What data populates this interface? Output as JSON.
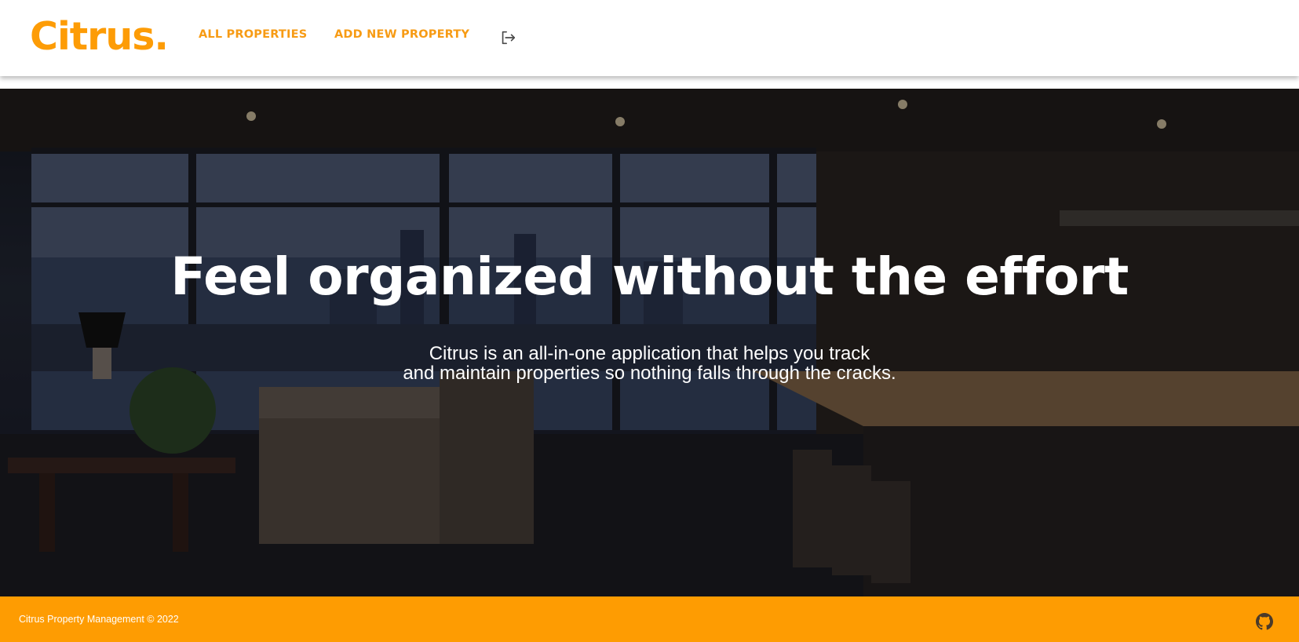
{
  "header": {
    "logo": "Citrus.",
    "nav": {
      "all_properties": "ALL PROPERTIES",
      "add_new_property": "ADD NEW PROPERTY"
    },
    "logout_icon": "logout-icon"
  },
  "hero": {
    "title": "Feel organized without the effort",
    "subtitle_line1": "Citrus is an all-in-one application that helps you track",
    "subtitle_line2": "and maintain properties so nothing falls through the cracks.",
    "background": "dark-interior-apartment-photo"
  },
  "footer": {
    "text": "Citrus Property Management © 2022",
    "github_icon": "github-icon"
  },
  "colors": {
    "brand_orange": "#fd9c06",
    "nav_orange": "#f79b14",
    "footer_orange": "#fe9c02",
    "text_white": "#ffffff"
  }
}
